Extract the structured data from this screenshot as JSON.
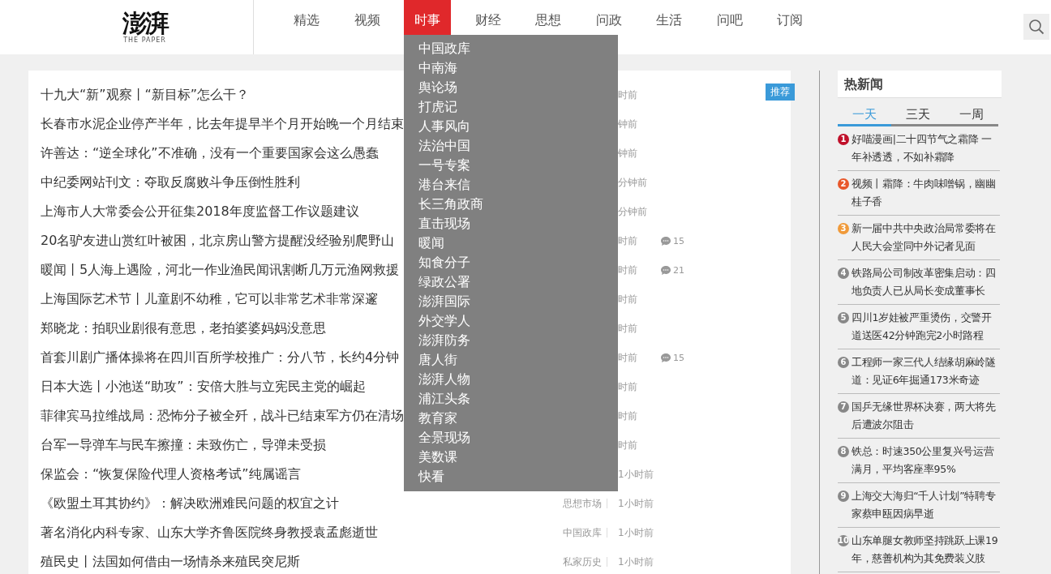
{
  "logo": {
    "mark": "澎湃",
    "tagline": "THE PAPER"
  },
  "nav": [
    {
      "label": "精选",
      "selected": false
    },
    {
      "label": "视频",
      "selected": false
    },
    {
      "label": "时事",
      "selected": true
    },
    {
      "label": "财经",
      "selected": false
    },
    {
      "label": "思想",
      "selected": false
    },
    {
      "label": "问政",
      "selected": false
    },
    {
      "label": "生活",
      "selected": false
    },
    {
      "label": "问吧",
      "selected": false
    },
    {
      "label": "订阅",
      "selected": false
    }
  ],
  "dropdown": [
    "中国政库",
    "中南海",
    "舆论场",
    "打虎记",
    "人事风向",
    "法治中国",
    "一号专案",
    "港台来信",
    "长三角政商",
    "直击现场",
    "暖闻",
    "知食分子",
    "绿政公署",
    "澎湃国际",
    "外交学人",
    "澎湃防务",
    "唐人街",
    "澎湃人物",
    "浦江头条",
    "教育家",
    "全景现场",
    "美数课",
    "快看"
  ],
  "news": [
    {
      "title": "十九大“新”观察丨“新目标”怎么干？",
      "time": "时前",
      "tag": "推荐"
    },
    {
      "title": "长春市水泥企业停产半年，比去年提早半个月开始晚一个月结束",
      "time": "钟前"
    },
    {
      "title": "许善达：“逆全球化”不准确，没有一个重要国家会这么愚蠢",
      "time": "钟前"
    },
    {
      "title": "中纪委网站刊文：夺取反腐败斗争压倒性胜利",
      "time": "分钟前"
    },
    {
      "title": "上海市人大常委会公开征集2018年度监督工作议题建议",
      "time": "分钟前"
    },
    {
      "title": "20名驴友进山赏红叶被困，北京房山警方提醒没经验别爬野山",
      "time": "时前",
      "comments": "15"
    },
    {
      "title": "暖闻丨5人海上遇险，河北一作业渔民闻讯割断几万元渔网救援",
      "time": "时前",
      "comments": "21"
    },
    {
      "title": "上海国际艺术节丨儿童剧不幼稚，它可以非常艺术非常深邃",
      "time": "时前"
    },
    {
      "title": "郑晓龙：拍职业剧很有意思，老拍婆婆妈妈没意思",
      "time": "时前"
    },
    {
      "title": "首套川剧广播体操将在四川百所学校推广：分八节，长约4分钟",
      "time": "时前",
      "comments": "15"
    },
    {
      "title": "日本大选丨小池送“助攻”：安倍大胜与立宪民主党的崛起",
      "time": "时前"
    },
    {
      "title": "菲律宾马拉维战局：恐怖分子被全歼，战斗已结束军方仍在清场",
      "time": "时前"
    },
    {
      "title": "台军一导弹车与民车擦撞：未致伤亡，导弹未受损",
      "time": "时前"
    },
    {
      "title": "保监会：“恢复保险代理人资格考试”纯属谣言",
      "time": "1小时前"
    },
    {
      "title": "《欧盟土耳其协约》：解决欧洲难民问题的权宜之计",
      "category": "思想市场",
      "time": "1小时前"
    },
    {
      "title": "著名消化内科专家、山东大学齐鲁医院终身教授袁孟彪逝世",
      "category": "中国政库",
      "time": "1小时前"
    },
    {
      "title": "殖民史丨法国如何借由一场情杀来殖民突尼斯",
      "category": "私家历史",
      "time": "1小时前"
    }
  ],
  "hot": {
    "title": "热新闻",
    "tabs": [
      {
        "label": "一天",
        "selected": true
      },
      {
        "label": "三天",
        "selected": false
      },
      {
        "label": "一周",
        "selected": false
      }
    ],
    "items": [
      {
        "rank": "1",
        "color": "#c0102a",
        "text": "好喵漫画|二十四节气之霜降 一年补透透，不如补霜降"
      },
      {
        "rank": "2",
        "color": "#e8572a",
        "text": "视频丨霜降：牛肉味噌锅，幽幽桂子香"
      },
      {
        "rank": "3",
        "color": "#f09a3a",
        "text": "新一届中共中央政治局常委将在人民大会堂同中外记者见面"
      },
      {
        "rank": "4",
        "color": "#888888",
        "text": "铁路局公司制改革密集启动：四地负责人已从局长变成董事长"
      },
      {
        "rank": "5",
        "color": "#888888",
        "text": "四川1岁娃被严重烫伤，交警开道送医42分钟跑完2小时路程"
      },
      {
        "rank": "6",
        "color": "#888888",
        "text": "工程师一家三代人结缘胡麻岭隧道：见证6年掘通173米奇迹"
      },
      {
        "rank": "7",
        "color": "#888888",
        "text": "国乒无缘世界杯决赛，两大将先后遭波尔阻击"
      },
      {
        "rank": "8",
        "color": "#888888",
        "text": "铁总：时速350公里复兴号运营满月，平均客座率95%"
      },
      {
        "rank": "9",
        "color": "#888888",
        "text": "上海交大海归“千人计划”特聘专家蔡申瓯因病早逝"
      },
      {
        "rank": "10",
        "color": "#888888",
        "text": "山东单腿女教师坚持跳跃上课19年，慈善机构为其免费装义肢"
      }
    ]
  }
}
